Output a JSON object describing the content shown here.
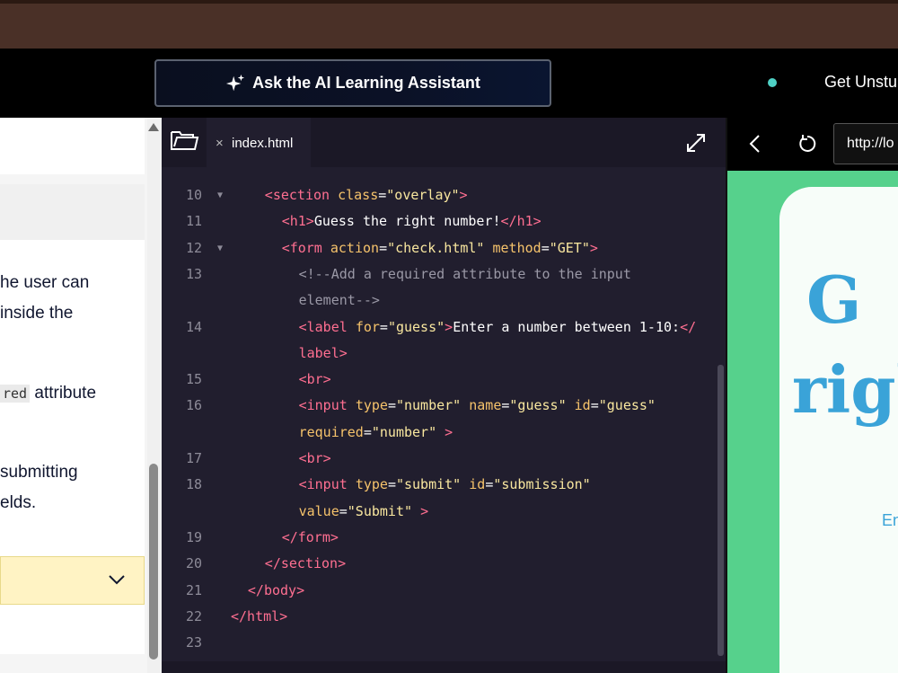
{
  "header": {
    "ai_button_label": "Ask the AI Learning Assistant",
    "unstuck_label": "Get Unstu"
  },
  "instructions": {
    "line1": "he user can",
    "line2": "inside the",
    "line3_code": "red",
    "line3_text": " attribute",
    "line4": "submitting",
    "line5": "elds."
  },
  "editor": {
    "tab_name": "index.html",
    "tab_close": "×",
    "lines": [
      {
        "n": "10",
        "fold": true,
        "indent": 2,
        "html": "<span class=\"t\">&lt;section</span> <span class=\"a\">class</span><span class=\"w\">=</span><span class=\"s\">\"overlay\"</span><span class=\"t\">&gt;</span>"
      },
      {
        "n": "11",
        "fold": false,
        "indent": 3,
        "html": "<span class=\"t\">&lt;h1&gt;</span><span class=\"w\">Guess the right number!</span><span class=\"t\">&lt;/h1&gt;</span>"
      },
      {
        "n": "12",
        "fold": true,
        "indent": 3,
        "html": "<span class=\"t\">&lt;form</span> <span class=\"a\">action</span><span class=\"w\">=</span><span class=\"s\">\"check.html\"</span> <span class=\"a\">method</span><span class=\"w\">=</span><span class=\"s\">\"GET\"</span><span class=\"t\">&gt;</span>"
      },
      {
        "n": "13",
        "fold": false,
        "indent": 4,
        "html": "<span class=\"c\">&lt;!--Add a required attribute to the input</span>"
      },
      {
        "n": "",
        "fold": false,
        "indent": 4,
        "html": "<span class=\"c\">element--&gt;</span>"
      },
      {
        "n": "14",
        "fold": false,
        "indent": 4,
        "html": "<span class=\"t\">&lt;label</span> <span class=\"a\">for</span><span class=\"w\">=</span><span class=\"s\">\"guess\"</span><span class=\"t\">&gt;</span><span class=\"w\">Enter a number between 1-10:</span><span class=\"t\">&lt;/</span>"
      },
      {
        "n": "",
        "fold": false,
        "indent": 4,
        "html": "<span class=\"t\">label&gt;</span>"
      },
      {
        "n": "15",
        "fold": false,
        "indent": 4,
        "html": "<span class=\"t\">&lt;br&gt;</span>"
      },
      {
        "n": "16",
        "fold": false,
        "indent": 4,
        "html": "<span class=\"t\">&lt;input</span> <span class=\"a\">type</span><span class=\"w\">=</span><span class=\"s\">\"number\"</span> <span class=\"a\">name</span><span class=\"w\">=</span><span class=\"s\">\"guess\"</span> <span class=\"a\">id</span><span class=\"w\">=</span><span class=\"s\">\"guess\"</span>"
      },
      {
        "n": "",
        "fold": false,
        "indent": 4,
        "html": "<span class=\"a\">required</span><span class=\"w\">=</span><span class=\"s\">\"number\"</span> <span class=\"t\">&gt;</span>"
      },
      {
        "n": "17",
        "fold": false,
        "indent": 4,
        "html": "<span class=\"t\">&lt;br&gt;</span>"
      },
      {
        "n": "18",
        "fold": false,
        "indent": 4,
        "html": "<span class=\"t\">&lt;input</span> <span class=\"a\">type</span><span class=\"w\">=</span><span class=\"s\">\"submit\"</span> <span class=\"a\">id</span><span class=\"w\">=</span><span class=\"s\">\"submission\"</span>"
      },
      {
        "n": "",
        "fold": false,
        "indent": 4,
        "html": "<span class=\"a\">value</span><span class=\"w\">=</span><span class=\"s\">\"Submit\"</span> <span class=\"t\">&gt;</span>"
      },
      {
        "n": "19",
        "fold": false,
        "indent": 3,
        "html": "<span class=\"t\">&lt;/form&gt;</span>"
      },
      {
        "n": "20",
        "fold": false,
        "indent": 2,
        "html": "<span class=\"t\">&lt;/section&gt;</span>"
      },
      {
        "n": "21",
        "fold": false,
        "indent": 1,
        "html": "<span class=\"t\">&lt;/body&gt;</span>"
      },
      {
        "n": "22",
        "fold": false,
        "indent": 0,
        "html": "<span class=\"t\">&lt;/html&gt;</span>"
      },
      {
        "n": "23",
        "fold": false,
        "indent": 0,
        "html": ""
      }
    ]
  },
  "preview": {
    "url": "http://lo",
    "heading_line1": "G",
    "heading_line2": "righ",
    "label_partial": "En"
  },
  "colors": {
    "tag": "#ff6f91",
    "attribute": "#f6c36b",
    "string": "#f9e79f",
    "comment": "#9a98a6",
    "preview_bg": "#56d18c",
    "preview_text": "#3aa3d8"
  },
  "icons": {
    "ai_button": "sparkle-icon",
    "hint": "chevron-down-icon",
    "editor_folder": "folder-icon",
    "editor_expand": "expand-icon",
    "preview_back": "chevron-left-icon",
    "preview_refresh": "refresh-icon"
  }
}
